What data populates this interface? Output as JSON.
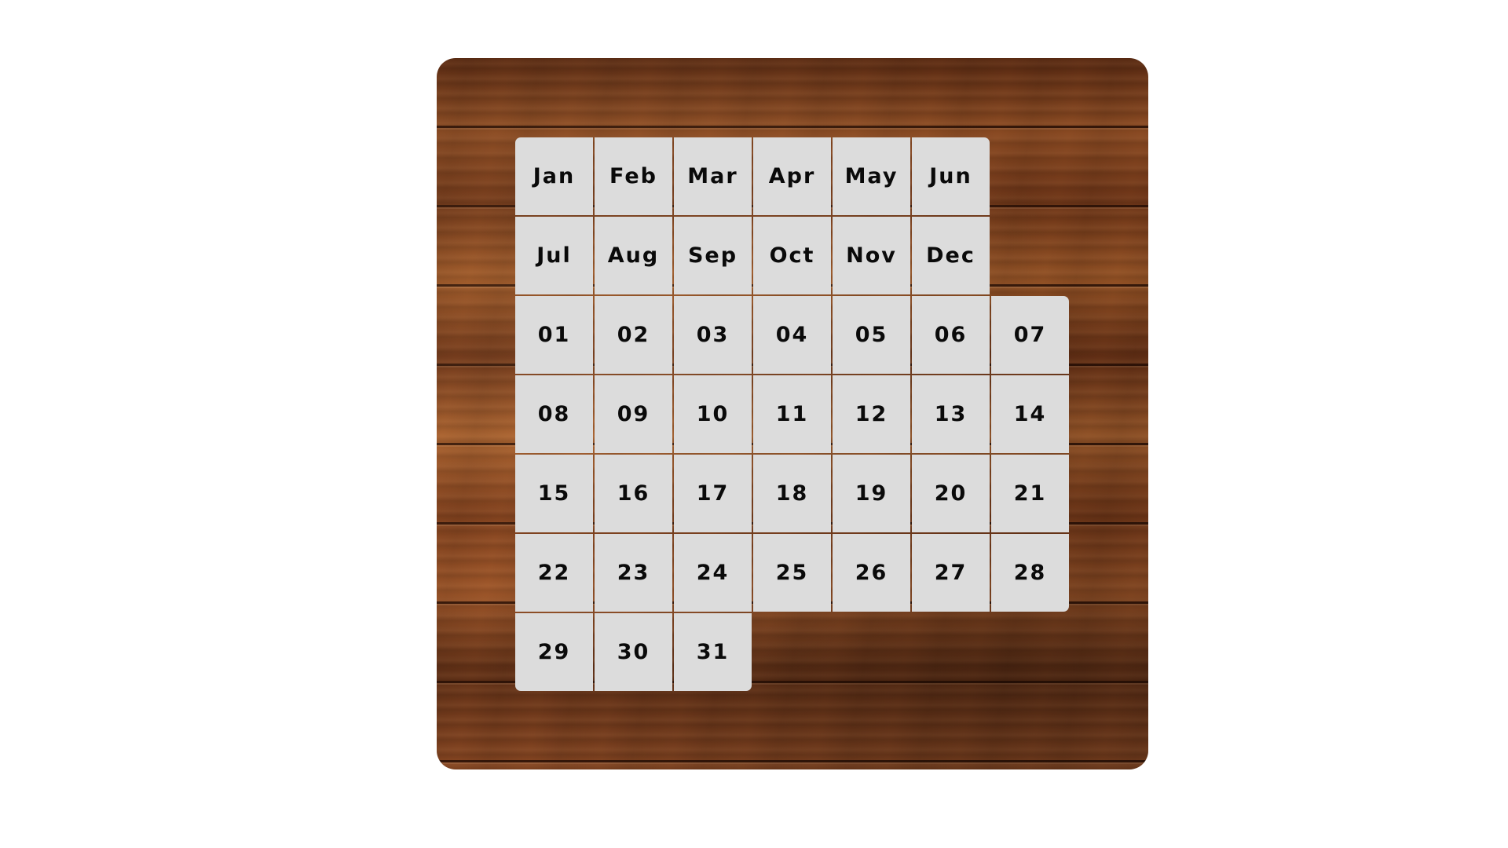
{
  "board": {
    "rows": [
      [
        "Jan",
        "Feb",
        "Mar",
        "Apr",
        "May",
        "Jun",
        null
      ],
      [
        "Jul",
        "Aug",
        "Sep",
        "Oct",
        "Nov",
        "Dec",
        null
      ],
      [
        "01",
        "02",
        "03",
        "04",
        "05",
        "06",
        "07"
      ],
      [
        "08",
        "09",
        "10",
        "11",
        "12",
        "13",
        "14"
      ],
      [
        "15",
        "16",
        "17",
        "18",
        "19",
        "20",
        "21"
      ],
      [
        "22",
        "23",
        "24",
        "25",
        "26",
        "27",
        "28"
      ],
      [
        "29",
        "30",
        "31",
        null,
        null,
        null,
        null
      ]
    ],
    "colors": {
      "cell": "#dcdcdc",
      "text": "#0a0a0a",
      "board_wood": "#7a3e1b",
      "background": "#ffffff"
    }
  }
}
